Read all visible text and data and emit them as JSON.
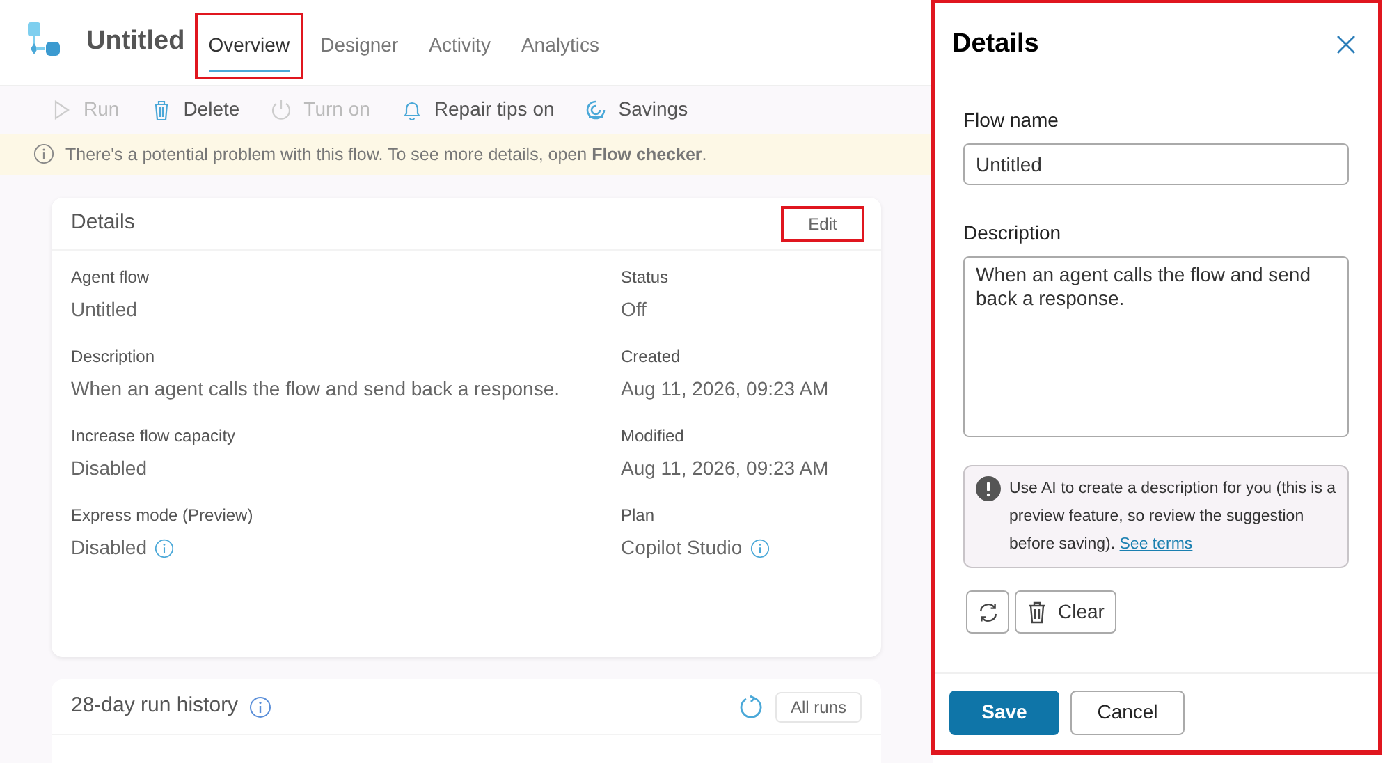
{
  "app": {
    "title": "Untitled"
  },
  "tabs": [
    {
      "label": "Overview",
      "selected": true,
      "highlighted": true
    },
    {
      "label": "Designer",
      "selected": false,
      "highlighted": false
    },
    {
      "label": "Activity",
      "selected": false,
      "highlighted": false
    },
    {
      "label": "Analytics",
      "selected": false,
      "highlighted": false
    }
  ],
  "toolbar": [
    {
      "kind": "run",
      "label": "Run",
      "disabled": true
    },
    {
      "kind": "delete",
      "label": "Delete",
      "disabled": false
    },
    {
      "kind": "power",
      "label": "Turn on",
      "disabled": true
    },
    {
      "kind": "bell",
      "label": "Repair tips on",
      "disabled": false
    },
    {
      "kind": "savings",
      "label": "Savings",
      "disabled": false
    }
  ],
  "banner": {
    "text": "There's a potential problem with this flow. To see more details, open **Flow checker**."
  },
  "details_card": {
    "title": "Details",
    "edit_button": {
      "label": "Edit",
      "highlighted": true
    },
    "fields": [
      {
        "label": "Agent flow",
        "value": "Untitled",
        "info": false
      },
      {
        "label": "Status",
        "value": "Off",
        "info": false
      },
      {
        "label": "Description",
        "value": "When an agent calls the flow and send back a response.",
        "info": false
      },
      {
        "label": "Created",
        "value": "Aug 11, 2026, 09:23 AM",
        "info": false
      },
      {
        "label": "Increase flow capacity",
        "value": "Disabled",
        "info": false
      },
      {
        "label": "Modified",
        "value": "Aug 11, 2026, 09:23 AM",
        "info": false
      },
      {
        "label": "Express mode (Preview)",
        "value": "Disabled",
        "info": true
      },
      {
        "label": "Plan",
        "value": "Copilot Studio",
        "info": true
      }
    ]
  },
  "run_history": {
    "title": "28-day run history",
    "all_runs": "All runs"
  },
  "panel": {
    "title": "Details",
    "highlighted": true,
    "flow_name": {
      "label": "Flow name",
      "value": "Untitled"
    },
    "description": {
      "label": "Description",
      "value": "When an agent calls the flow and send back a response."
    },
    "ai_notice": {
      "text": "Use AI to create a description for you (this is a preview feature, so review the suggestion before saving).",
      "link": "See terms"
    },
    "clear_button": "Clear",
    "save": "Save",
    "cancel": "Cancel"
  }
}
